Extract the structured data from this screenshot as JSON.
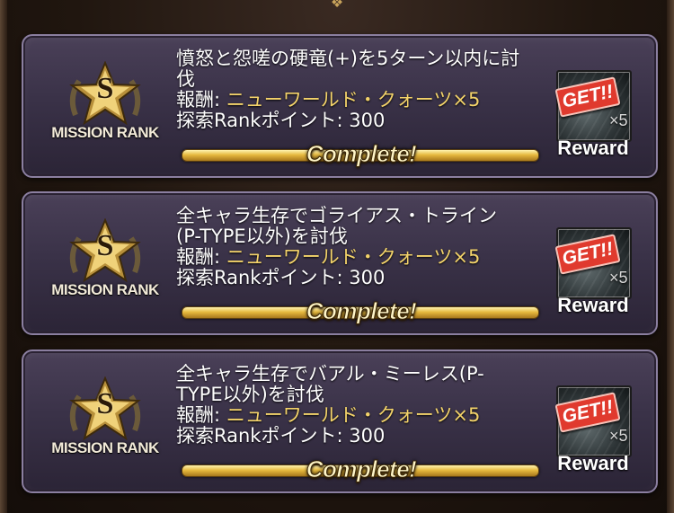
{
  "missions": [
    {
      "rank": "S",
      "rank_label": "MISSION RANK",
      "title_line1": "憤怒と怨嗟の硬竜(+)を5ターン以内に討",
      "title_line2": "伐",
      "reward_prefix": "報酬: ",
      "reward_value": "ニューワールド・クォーツ×5",
      "points_text": "探索Rankポイント: 300",
      "status": "Complete!",
      "get_label": "GET!!",
      "quantity": "×5",
      "reward_label": "Reward",
      "progress": 1.0
    },
    {
      "rank": "S",
      "rank_label": "MISSION RANK",
      "title_line1": "全キャラ生存でゴライアス・トライン",
      "title_line2": "(P-TYPE以外)を討伐",
      "reward_prefix": "報酬: ",
      "reward_value": "ニューワールド・クォーツ×5",
      "points_text": "探索Rankポイント: 300",
      "status": "Complete!",
      "get_label": "GET!!",
      "quantity": "×5",
      "reward_label": "Reward",
      "progress": 1.0
    },
    {
      "rank": "S",
      "rank_label": "MISSION RANK",
      "title_line1": "全キャラ生存でバアル・ミーレス(P-",
      "title_line2": "TYPE以外)を討伐",
      "reward_prefix": "報酬: ",
      "reward_value": "ニューワールド・クォーツ×5",
      "points_text": "探索Rankポイント: 300",
      "status": "Complete!",
      "get_label": "GET!!",
      "quantity": "×5",
      "reward_label": "Reward",
      "progress": 1.0
    }
  ],
  "colors": {
    "card_top": "#4a4058",
    "card_bottom": "#2b2436",
    "reward_value": "#f3d36a",
    "gold": "#e6b93e",
    "stamp_red": "#e03a2e"
  },
  "icons": {
    "rank": "star-laurel-badge-icon",
    "reward": "quartz-item-icon",
    "ornament": "top-ornament-icon"
  }
}
